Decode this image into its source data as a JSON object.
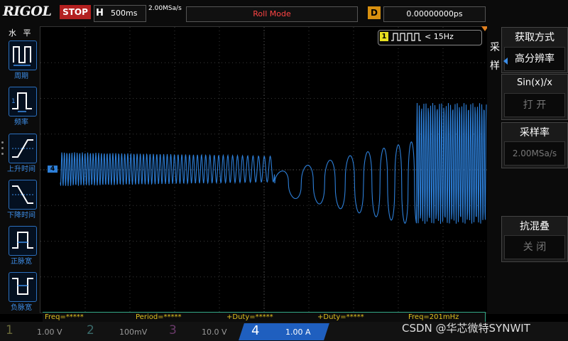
{
  "header": {
    "brand": "RIGOL",
    "run_state": "STOP",
    "timebase_key": "H",
    "timebase": "500ms",
    "sample_rate": "2.00MSa/s",
    "mode": "Roll Mode",
    "delay_key": "D",
    "delay": "0.00000000ps"
  },
  "left_menu": {
    "title": "水 平",
    "items": [
      {
        "label": "周期",
        "icon": "period-icon"
      },
      {
        "label": "频率",
        "icon": "frequency-icon"
      },
      {
        "label": "上升时间",
        "icon": "rise-time-icon"
      },
      {
        "label": "下降时间",
        "icon": "fall-time-icon"
      },
      {
        "label": "正脉宽",
        "icon": "positive-pulse-icon"
      },
      {
        "label": "负脉宽",
        "icon": "negative-pulse-icon"
      }
    ]
  },
  "trigger": {
    "channel": "1",
    "condition": "< 15Hz"
  },
  "ch4_marker": "4",
  "right_menu": {
    "side_label": "采 样",
    "acquire_title": "获取方式",
    "acquire_value": "高分辨率",
    "sinx_title": "Sin(x)/x",
    "sinx_value": "打 开",
    "srate_title": "采样率",
    "srate_value": "2.00MSa/s",
    "alias_title": "抗混叠",
    "alias_value": "关 闭"
  },
  "measurements": [
    "Freq=*****",
    "Period=*****",
    "+Duty=*****",
    "+Duty=*****",
    "Freq=201mHz"
  ],
  "channels": [
    {
      "num": "1",
      "value": "1.00 V",
      "color": "#6a6a3a"
    },
    {
      "num": "2",
      "value": "100mV",
      "color": "#3a6a6a"
    },
    {
      "num": "3",
      "value": "10.0 V",
      "color": "#6a3a6a"
    },
    {
      "num": "4",
      "value": "1.00 A",
      "color": "#1f5fbf"
    }
  ],
  "watermark": "CSDN @华芯微特SYNWIT",
  "colors": {
    "trace": "#2d7fd8",
    "grid": "#3a3a3a",
    "stop": "#b32020",
    "delay_key": "#d89010"
  }
}
